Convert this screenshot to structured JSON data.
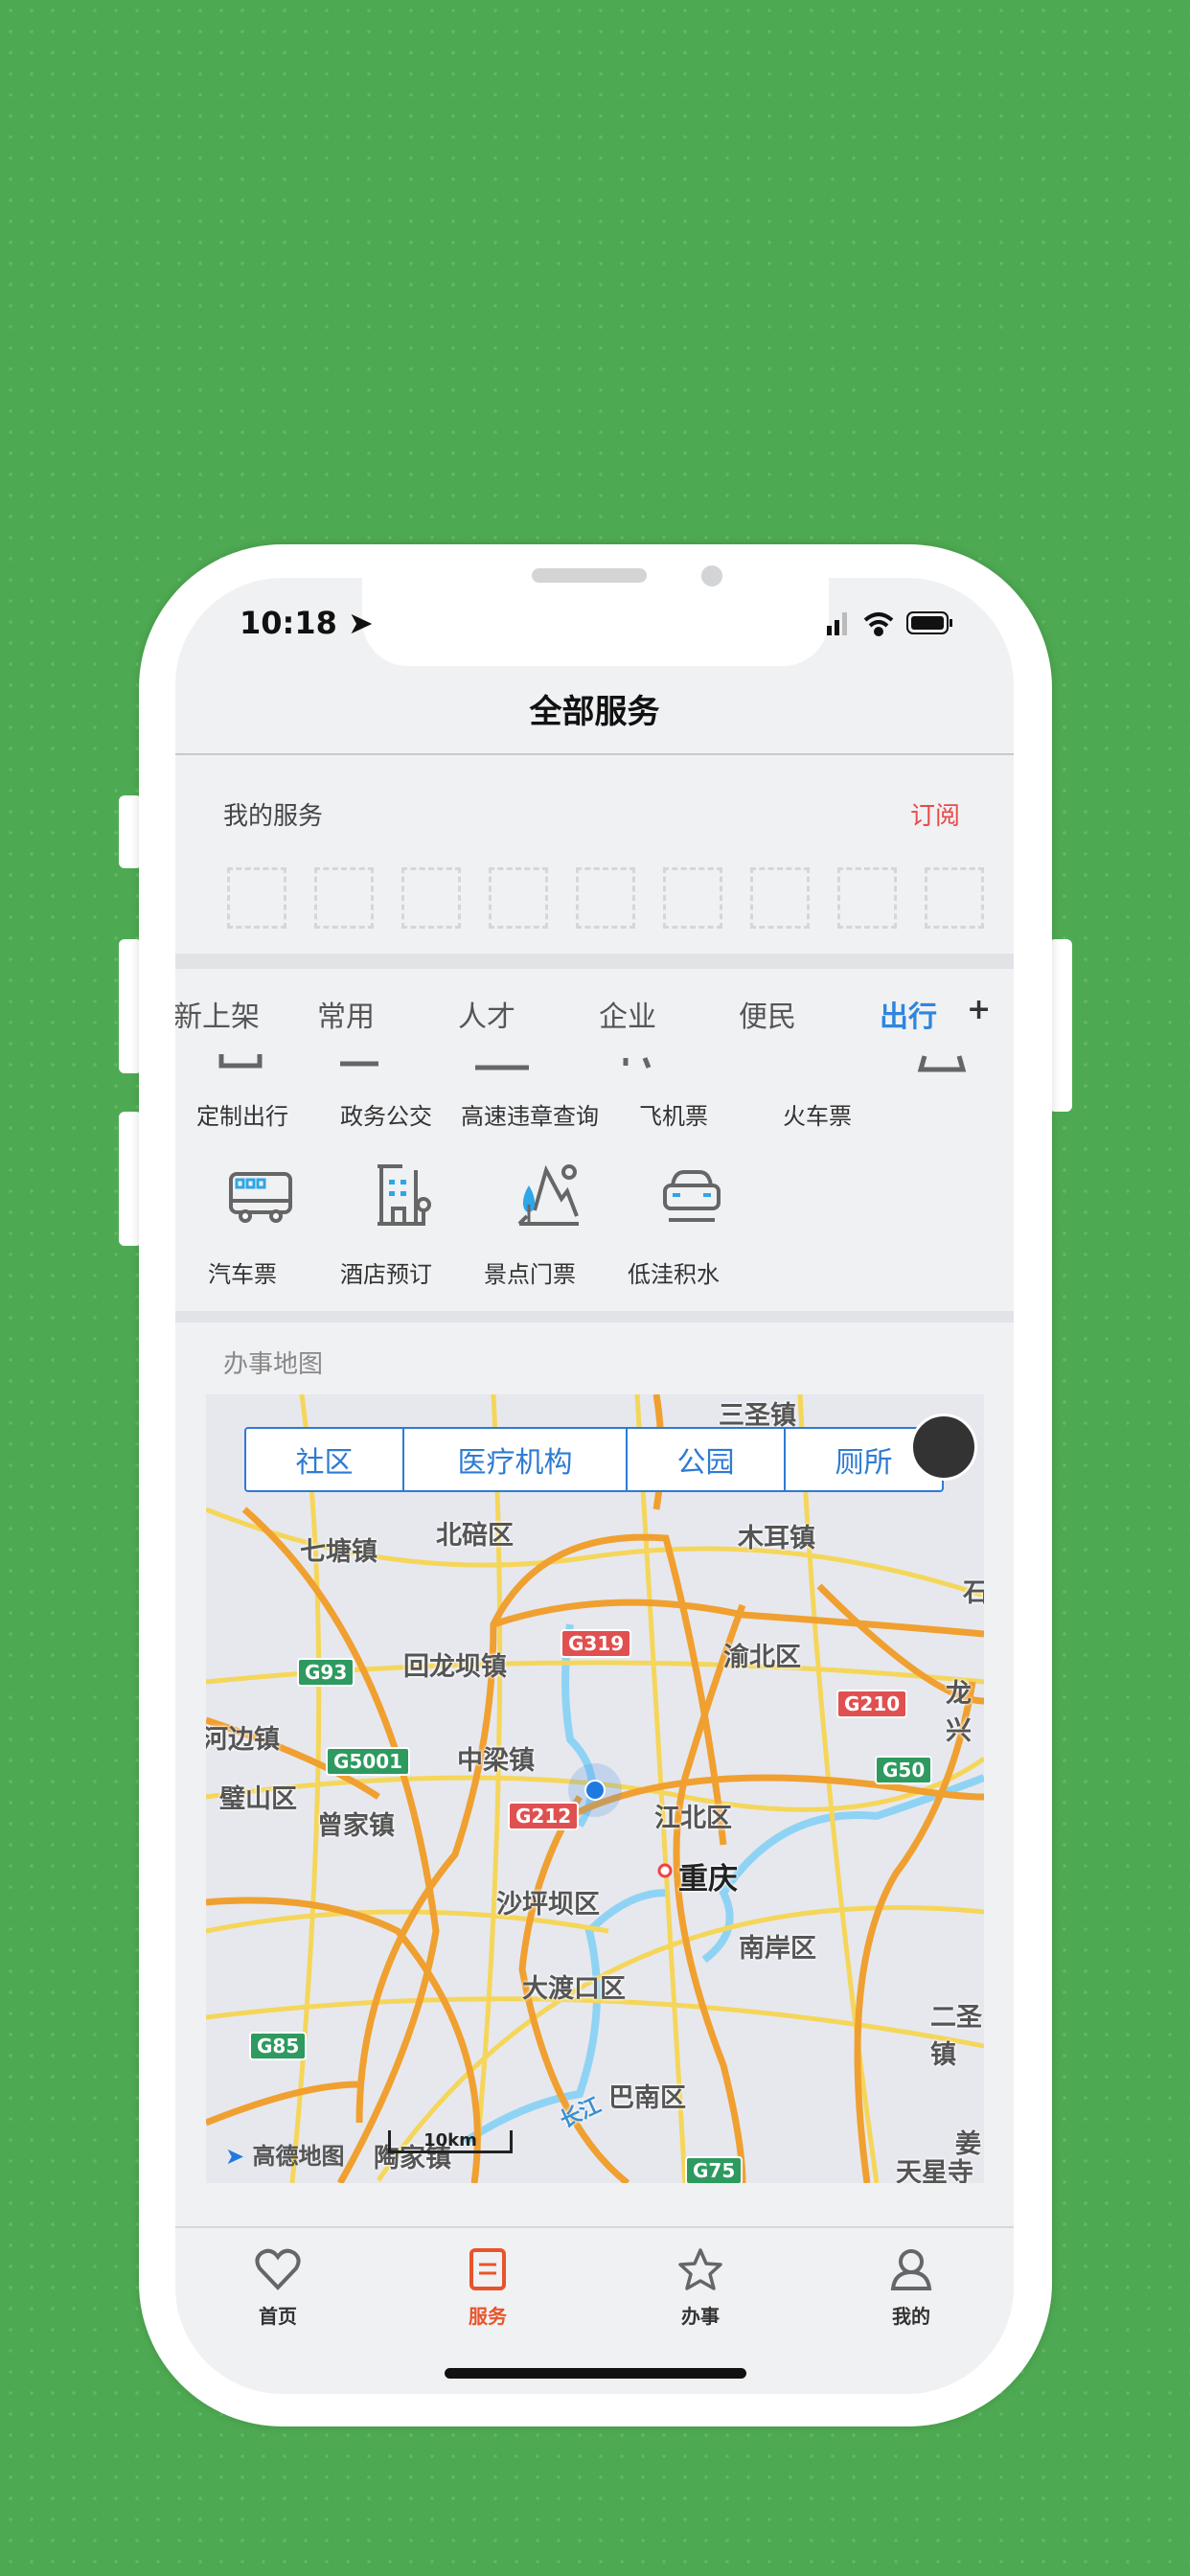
{
  "status": {
    "time": "10:18"
  },
  "header": {
    "title": "全部服务"
  },
  "my_services": {
    "label": "我的服务",
    "subscribe": "订阅",
    "slots": 9
  },
  "tabs": [
    {
      "label": "新上架"
    },
    {
      "label": "常用"
    },
    {
      "label": "人才"
    },
    {
      "label": "企业"
    },
    {
      "label": "便民"
    },
    {
      "label": "出行",
      "active": true
    }
  ],
  "tabs_add": "+",
  "services_row1": [
    {
      "label": "定制出行"
    },
    {
      "label": "政务公交"
    },
    {
      "label": "高速违章查询"
    },
    {
      "label": "飞机票"
    },
    {
      "label": "火车票"
    }
  ],
  "services_row2": [
    {
      "label": "汽车票",
      "icon": "bus-icon"
    },
    {
      "label": "酒店预订",
      "icon": "hotel-icon"
    },
    {
      "label": "景点门票",
      "icon": "scenic-icon"
    },
    {
      "label": "低洼积水",
      "icon": "car-icon"
    }
  ],
  "map": {
    "title": "办事地图",
    "filters": [
      "社区",
      "医疗机构",
      "公园",
      "厕所"
    ],
    "places": [
      "三圣镇",
      "北碚区",
      "七塘镇",
      "木耳镇",
      "渝北区",
      "回龙坝镇",
      "龙兴",
      "河边镇",
      "中梁镇",
      "江北区",
      "璧山区",
      "重庆",
      "曾家镇",
      "沙坪坝区",
      "南岸区",
      "大渡口区",
      "二圣镇",
      "长江",
      "巴南区",
      "姜",
      "天星寺镇",
      "陶家镇",
      "石"
    ],
    "highways": [
      "G319",
      "G93",
      "G210",
      "G5001",
      "G50",
      "G212",
      "G85",
      "G75"
    ],
    "attribution": "高德地图",
    "scale": "10km"
  },
  "tabbar": [
    {
      "label": "首页",
      "icon": "heart-icon"
    },
    {
      "label": "服务",
      "icon": "document-icon",
      "active": true
    },
    {
      "label": "办事",
      "icon": "star-icon"
    },
    {
      "label": "我的",
      "icon": "user-icon"
    }
  ],
  "colors": {
    "accent_blue": "#2e7bd2",
    "active_orange": "#e8542a",
    "subscribe_red": "#e84a4a",
    "background_green": "#4eaa52"
  }
}
